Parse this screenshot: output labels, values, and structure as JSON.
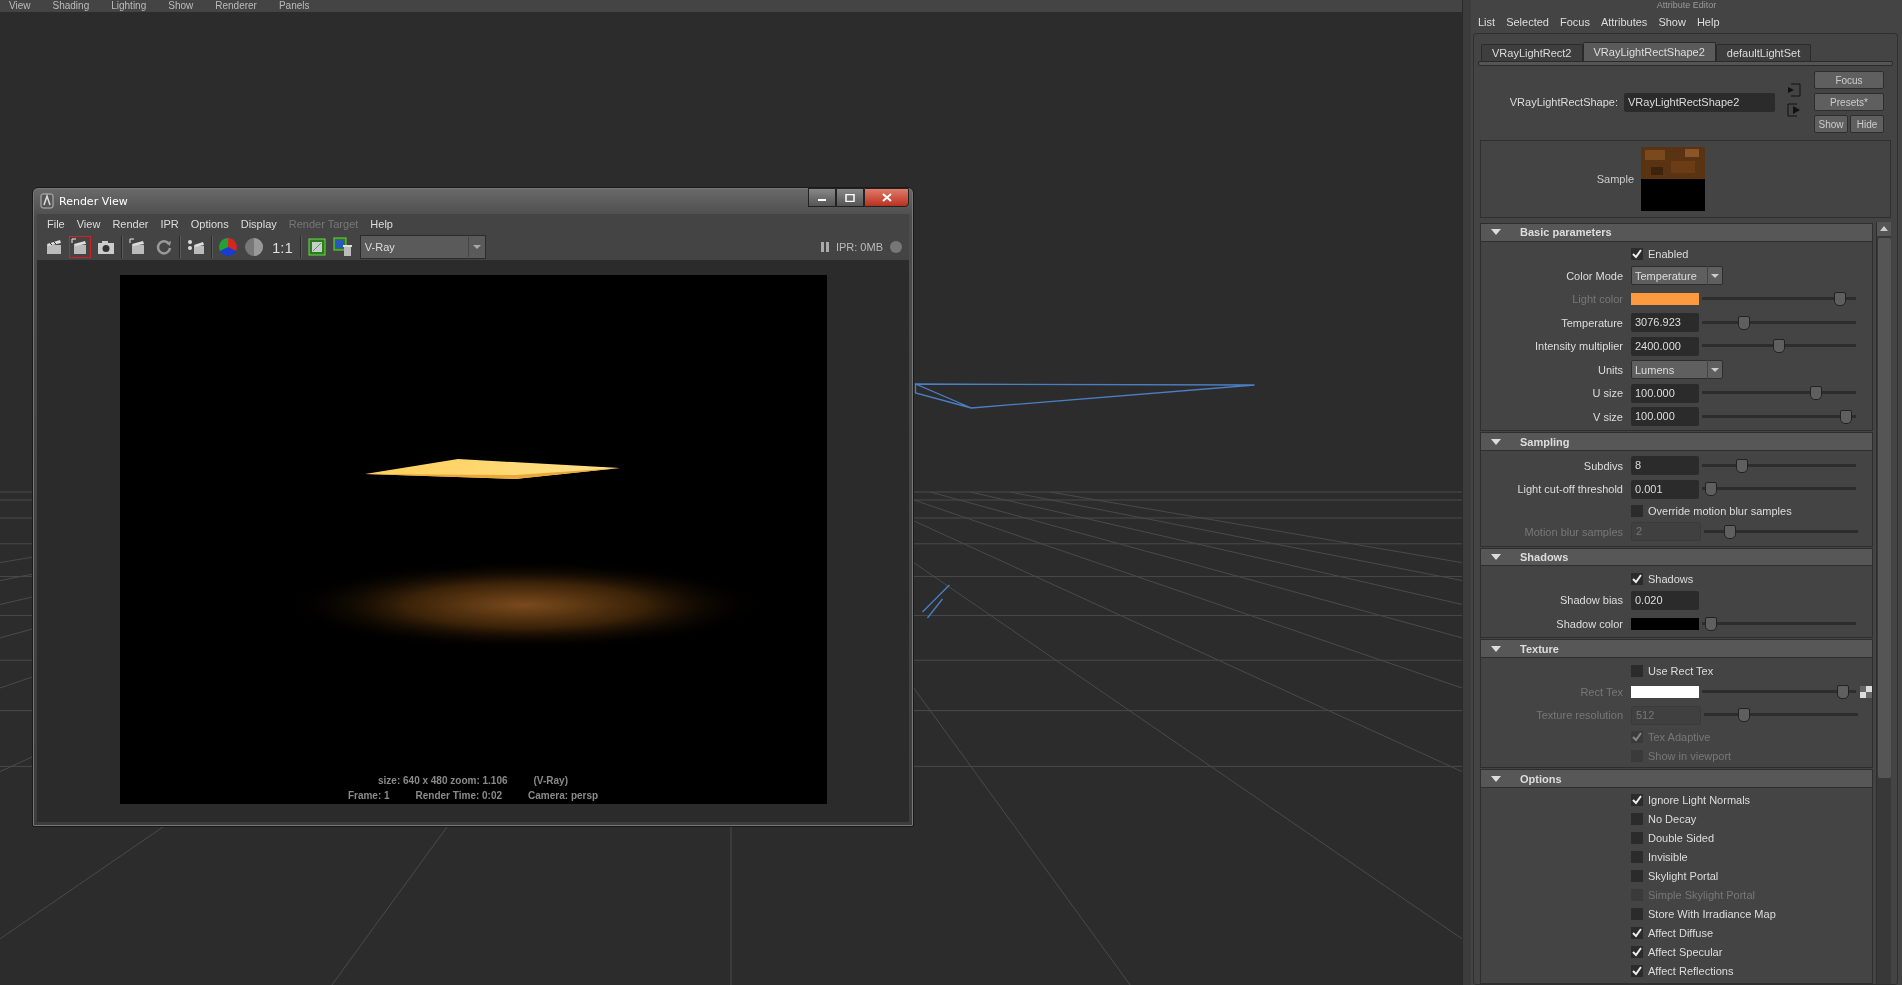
{
  "viewport": {
    "menu": [
      {
        "label": "View"
      },
      {
        "label": "Shading"
      },
      {
        "label": "Lighting"
      },
      {
        "label": "Show"
      },
      {
        "label": "Renderer"
      },
      {
        "label": "Panels"
      }
    ]
  },
  "render_view": {
    "title": "Render View",
    "menu": [
      {
        "label": "File",
        "disabled": false
      },
      {
        "label": "View",
        "disabled": false
      },
      {
        "label": "Render",
        "disabled": false
      },
      {
        "label": "IPR",
        "disabled": false
      },
      {
        "label": "Options",
        "disabled": false
      },
      {
        "label": "Display",
        "disabled": false
      },
      {
        "label": "Render Target",
        "disabled": true
      },
      {
        "label": "Help",
        "disabled": false
      }
    ],
    "toolbar": [
      {
        "kind": "clapper",
        "selected": false
      },
      {
        "kind": "clapper-region",
        "selected": true
      },
      {
        "kind": "camera",
        "selected": false
      },
      {
        "kind": "separator"
      },
      {
        "kind": "clapper-region",
        "selected": false
      },
      {
        "kind": "refresh",
        "selected": false
      },
      {
        "kind": "separator"
      },
      {
        "kind": "clapper-dots",
        "selected": false
      },
      {
        "kind": "separator"
      },
      {
        "kind": "color-wheel",
        "selected": false
      },
      {
        "kind": "grey-circle",
        "selected": false
      },
      {
        "kind": "text",
        "label": "1:1",
        "selected": false
      },
      {
        "kind": "separator"
      },
      {
        "kind": "frame",
        "selected": false
      },
      {
        "kind": "frame-trash",
        "selected": false
      }
    ],
    "renderer": "V-Ray",
    "ipr_status": "IPR: 0MB",
    "status_lines": [
      {
        "items": [
          "size: 640 x 480 zoom: 1.106",
          "(V-Ray)"
        ]
      },
      {
        "items": [
          "Frame: 1",
          "Render Time: 0:02",
          "Camera: persp"
        ]
      }
    ]
  },
  "attribute_editor": {
    "title": "Attribute Editor",
    "menu": [
      {
        "label": "List"
      },
      {
        "label": "Selected"
      },
      {
        "label": "Focus"
      },
      {
        "label": "Attributes"
      },
      {
        "label": "Show"
      },
      {
        "label": "Help"
      }
    ],
    "tabs": [
      {
        "label": "VRayLightRect2",
        "selected": false
      },
      {
        "label": "VRayLightRectShape2",
        "selected": true
      },
      {
        "label": "defaultLightSet",
        "selected": false
      }
    ],
    "node_label": "VRayLightRectShape:",
    "node_name": "VRayLightRectShape2",
    "buttons": [
      {
        "label": "Focus"
      },
      {
        "label": "Presets*"
      },
      {
        "label": "Show"
      },
      {
        "label": "Hide"
      }
    ],
    "sample_label": "Sample",
    "sections": [
      {
        "title": "Basic parameters",
        "expanded": true,
        "rows": [
          {
            "kind": "checkbox",
            "label": "Enabled",
            "checked": true,
            "disabled": false
          },
          {
            "kind": "dropdown",
            "label": "Color Mode",
            "value": "Temperature"
          },
          {
            "kind": "color",
            "label": "Light color",
            "color": "#fd9a40",
            "level": 0.93,
            "disabled": true
          },
          {
            "kind": "number",
            "label": "Temperature",
            "value": "3076.923",
            "level": 0.25,
            "disabled": false
          },
          {
            "kind": "number",
            "label": "Intensity multiplier",
            "value": "2400.000",
            "level": 0.5,
            "disabled": false
          },
          {
            "kind": "dropdown",
            "label": "Units",
            "value": "Lumens"
          },
          {
            "kind": "number",
            "label": "U size",
            "value": "100.000",
            "level": 0.76,
            "disabled": false
          },
          {
            "kind": "number",
            "label": "V size",
            "value": "100.000",
            "level": 0.97,
            "disabled": false
          }
        ]
      },
      {
        "title": "Sampling",
        "expanded": true,
        "rows": [
          {
            "kind": "number",
            "label": "Subdivs",
            "value": "8",
            "level": 0.24,
            "disabled": false
          },
          {
            "kind": "number",
            "label": "Light cut-off threshold",
            "value": "0.001",
            "level": 0.02,
            "disabled": false
          },
          {
            "kind": "checkbox",
            "label": "Override motion blur samples",
            "checked": false,
            "disabled": false
          },
          {
            "kind": "number",
            "label": "Motion blur samples",
            "value": "2",
            "level": 0.14,
            "disabled": true
          }
        ]
      },
      {
        "title": "Shadows",
        "expanded": true,
        "rows": [
          {
            "kind": "checkbox",
            "label": "Shadows",
            "checked": true,
            "disabled": false
          },
          {
            "kind": "number",
            "label": "Shadow bias",
            "value": "0.020",
            "disabled": false
          },
          {
            "kind": "color",
            "label": "Shadow color",
            "color": "#000000",
            "level": 0.02,
            "disabled": false
          }
        ]
      },
      {
        "title": "Texture",
        "expanded": true,
        "rows": [
          {
            "kind": "checkbox",
            "label": "Use Rect Tex",
            "checked": false,
            "disabled": false
          },
          {
            "kind": "color",
            "label": "Rect Tex",
            "color": "#ffffff",
            "level": 0.95,
            "disabled": true,
            "map_button": true
          },
          {
            "kind": "number",
            "label": "Texture resolution",
            "value": "512",
            "level": 0.24,
            "disabled": true
          },
          {
            "kind": "checkbox",
            "label": "Tex Adaptive",
            "checked": true,
            "disabled": true
          },
          {
            "kind": "checkbox",
            "label": "Show in viewport",
            "checked": false,
            "disabled": true
          }
        ]
      },
      {
        "title": "Options",
        "expanded": true,
        "rows": [
          {
            "kind": "checkbox",
            "label": "Ignore Light Normals",
            "checked": true,
            "disabled": false
          },
          {
            "kind": "checkbox",
            "label": "No Decay",
            "checked": false,
            "disabled": false
          },
          {
            "kind": "checkbox",
            "label": "Double Sided",
            "checked": false,
            "disabled": false
          },
          {
            "kind": "checkbox",
            "label": "Invisible",
            "checked": false,
            "disabled": false
          },
          {
            "kind": "checkbox",
            "label": "Skylight Portal",
            "checked": false,
            "disabled": false
          },
          {
            "kind": "checkbox",
            "label": "Simple Skylight Portal",
            "checked": false,
            "disabled": true
          },
          {
            "kind": "checkbox",
            "label": "Store With Irradiance Map",
            "checked": false,
            "disabled": false
          },
          {
            "kind": "checkbox",
            "label": "Affect Diffuse",
            "checked": true,
            "disabled": false
          },
          {
            "kind": "checkbox",
            "label": "Affect Specular",
            "checked": true,
            "disabled": false
          },
          {
            "kind": "checkbox",
            "label": "Affect Reflections",
            "checked": true,
            "disabled": false
          }
        ]
      }
    ]
  }
}
